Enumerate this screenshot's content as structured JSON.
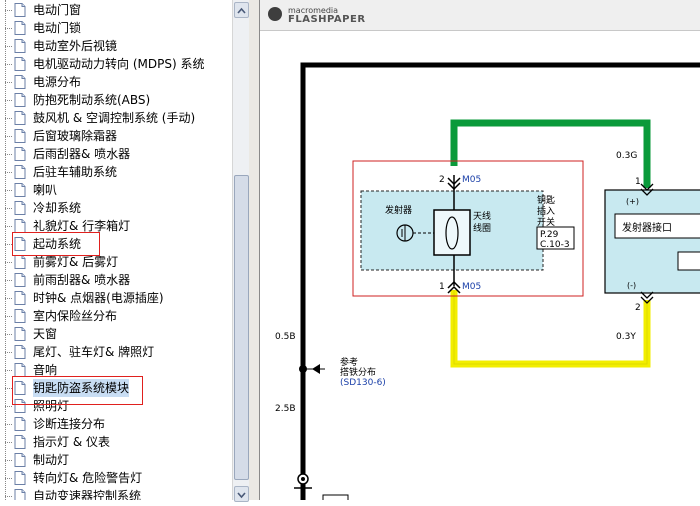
{
  "tree": {
    "items": [
      {
        "label": "电动门窗"
      },
      {
        "label": "电动门锁"
      },
      {
        "label": "电动室外后视镜"
      },
      {
        "label": "电机驱动动力转向 (MDPS) 系统"
      },
      {
        "label": "电源分布"
      },
      {
        "label": "防抱死制动系统(ABS)"
      },
      {
        "label": "鼓风机 & 空调控制系统 (手动)"
      },
      {
        "label": "后窗玻璃除霜器"
      },
      {
        "label": "后雨刮器& 喷水器"
      },
      {
        "label": "后驻车辅助系统"
      },
      {
        "label": "喇叭"
      },
      {
        "label": "冷却系统"
      },
      {
        "label": "礼貌灯& 行李箱灯"
      },
      {
        "label": "起动系统"
      },
      {
        "label": "前雾灯& 后雾灯"
      },
      {
        "label": "前雨刮器& 喷水器"
      },
      {
        "label": "时钟& 点烟器(电源插座)"
      },
      {
        "label": "室内保险丝分布"
      },
      {
        "label": "天窗"
      },
      {
        "label": "尾灯、驻车灯& 牌照灯"
      },
      {
        "label": "音响"
      },
      {
        "label": "钥匙防盗系统模块"
      },
      {
        "label": "照明灯"
      },
      {
        "label": "诊断连接分布"
      },
      {
        "label": "指示灯 & 仪表"
      },
      {
        "label": "制动灯"
      },
      {
        "label": "转向灯& 危险警告灯"
      },
      {
        "label": "自动变速器控制系统"
      }
    ],
    "selected_index": 21
  },
  "viewer": {
    "brand_small": "macromedia",
    "brand_big": "FLASHPAPER"
  },
  "diagram": {
    "connector_top": "M05",
    "connector_top_pin": "2",
    "connector_bottom": "M05",
    "connector_bottom_pin": "1",
    "emitter": "发射器",
    "coil": "天线\n线圈",
    "switch_label": "钥匙\n插入\n开关",
    "page_ref_1": "P.29",
    "page_ref_2": "C.10-3",
    "wire_green": "0.3G",
    "wire_yellow": "0.3Y",
    "wire_b1": "0.5B",
    "wire_b2": "2.5B",
    "pin_right_top": "1",
    "pin_right_bottom": "2",
    "plus": "(+)",
    "minus": "(-)",
    "port_label": "发射器接口",
    "ref_1": "参考",
    "ref_2": "搭铁分布",
    "ref_3": "(SD130-6)",
    "colors": {
      "green": "#0a9a3a",
      "yellow": "#f2ee00",
      "box_red": "#cf2020",
      "panel": "#c8e9f0",
      "blue_text": "#1a3fa8"
    }
  }
}
